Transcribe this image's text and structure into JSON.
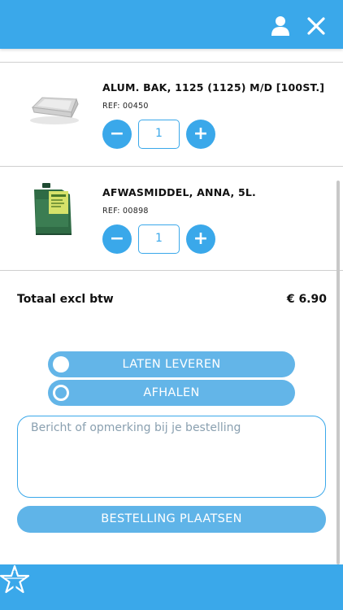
{
  "header": {
    "user_icon": "user-icon",
    "close_icon": "close-icon",
    "accent_color": "#3aa8ea"
  },
  "cart": {
    "items": [
      {
        "name": "ALUM. BAK, 1125 (1125) M/D [100ST.]",
        "ref": "REF: 00450",
        "quantity": "1",
        "image": "aluminium-tray-image"
      },
      {
        "name": "AFWASMIDDEL, ANNA, 5L.",
        "ref": "REF: 00898",
        "quantity": "1",
        "image": "detergent-jerrycan-image"
      }
    ],
    "minus_symbol": "−",
    "plus_symbol": "+"
  },
  "total": {
    "label": "Totaal excl btw",
    "value": "€ 6.90"
  },
  "delivery": {
    "options": [
      {
        "label": "LATEN LEVEREN",
        "selected": false
      },
      {
        "label": "AFHALEN",
        "selected": true
      }
    ]
  },
  "remark": {
    "placeholder": "Bericht of opmerking bij je bestelling",
    "value": ""
  },
  "submit": {
    "label": "BESTELLING PLAATSEN"
  },
  "footer": {
    "logo_icon": "star-logo-icon"
  }
}
